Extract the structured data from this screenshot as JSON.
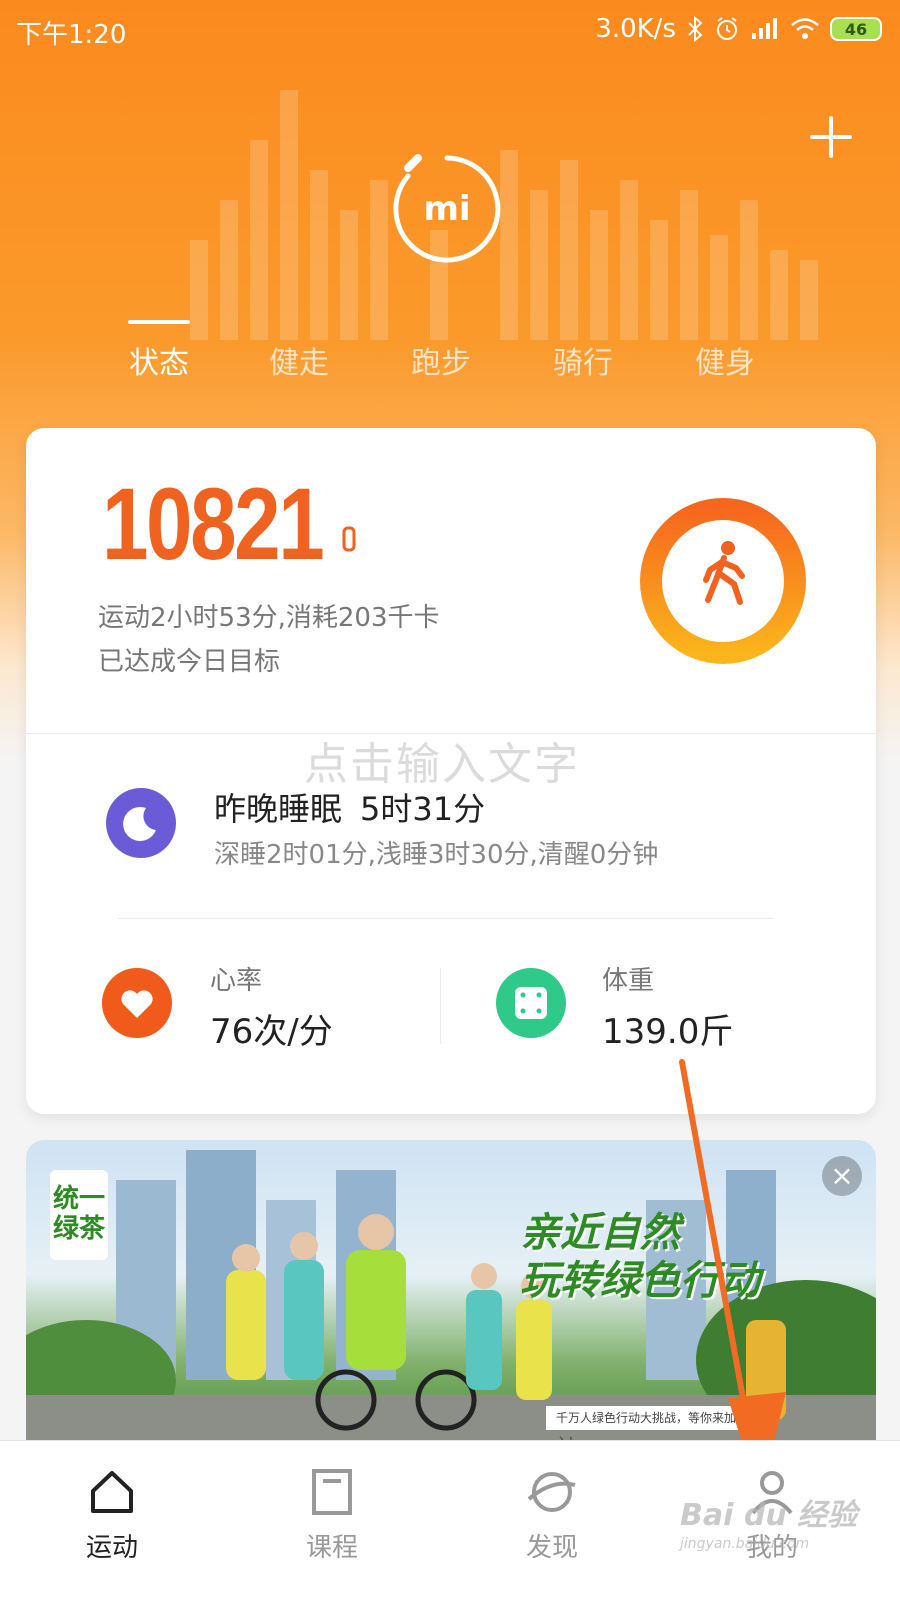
{
  "status_bar": {
    "time": "下午1:20",
    "network_speed": "3.0K/s",
    "battery": "46",
    "icons": [
      "bluetooth-icon",
      "alarm-icon",
      "signal-icon",
      "wifi-icon",
      "battery-icon"
    ]
  },
  "header": {
    "logo": "mi",
    "tabs": [
      {
        "label": "状态",
        "active": true
      },
      {
        "label": "健走",
        "active": false
      },
      {
        "label": "跑步",
        "active": false
      },
      {
        "label": "骑行",
        "active": false
      },
      {
        "label": "健身",
        "active": false
      }
    ]
  },
  "activity": {
    "steps": "10821",
    "line1": "运动2小时53分,消耗203千卡",
    "line2": "已达成今日目标",
    "goal_progress": 1.0
  },
  "overlay_text": "点击输入文字",
  "sleep": {
    "title": "昨晚睡眠",
    "duration": "5时31分",
    "detail": "深睡2时01分,浅睡3时30分,清醒0分钟"
  },
  "heart_rate": {
    "label": "心率",
    "value": "76次/分"
  },
  "weight": {
    "label": "体重",
    "value": "139.0斤"
  },
  "banner": {
    "brand": "统一 绿茶",
    "slogan_line1": "亲近自然",
    "slogan_line2": "玩转绿色行动",
    "ad_text": "千万人绿色行动大挑战，等你来加入！"
  },
  "bottom_nav": [
    {
      "label": "运动",
      "icon": "home-icon",
      "active": true
    },
    {
      "label": "课程",
      "icon": "course-icon",
      "active": false
    },
    {
      "label": "发现",
      "icon": "discover-icon",
      "active": false
    },
    {
      "label": "我的",
      "icon": "profile-icon",
      "active": false
    }
  ],
  "watermark": {
    "text": "Bai du 经验",
    "sub": "jingyan.baidu.com"
  },
  "colors": {
    "accent": "#f0621f",
    "header_orange": "#fb8a1e",
    "sleep_purple": "#6b5bd6",
    "heart_orange": "#f05a1a",
    "weight_green": "#2fc98a"
  }
}
